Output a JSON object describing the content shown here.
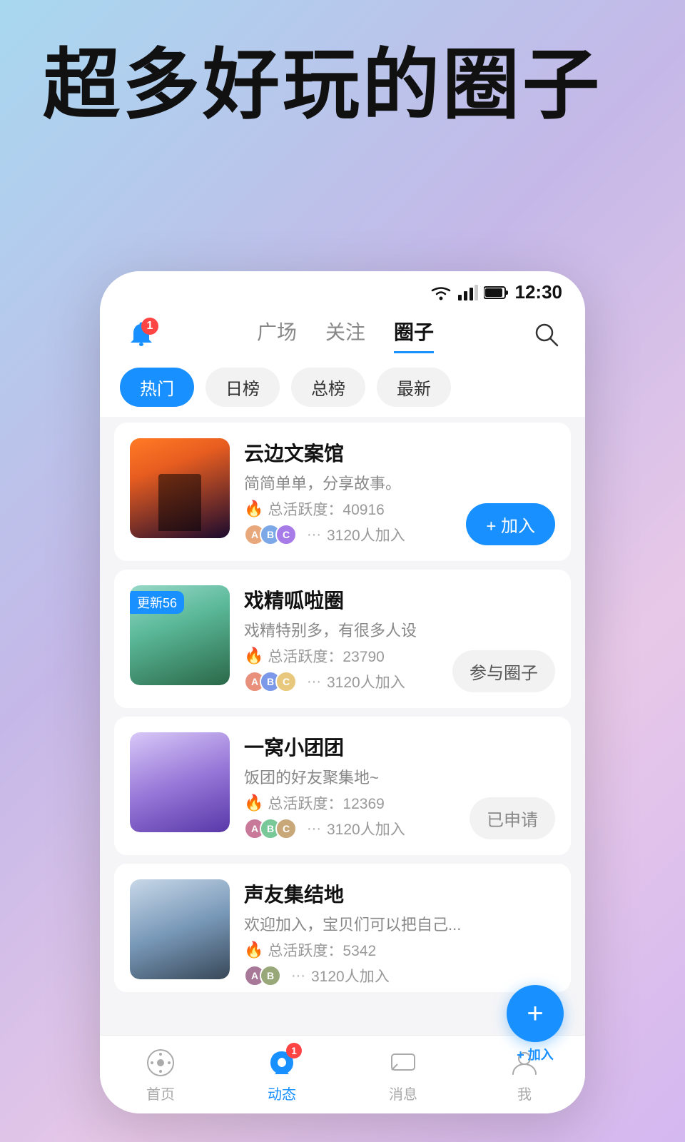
{
  "hero": {
    "title": "超多好玩的圈子"
  },
  "statusBar": {
    "time": "12:30"
  },
  "navBar": {
    "bellBadge": "1",
    "tabs": [
      {
        "label": "广场",
        "active": false
      },
      {
        "label": "关注",
        "active": false
      },
      {
        "label": "圈子",
        "active": true
      }
    ]
  },
  "filters": [
    {
      "label": "热门",
      "active": true
    },
    {
      "label": "日榜",
      "active": false
    },
    {
      "label": "总榜",
      "active": false
    },
    {
      "label": "最新",
      "active": false
    }
  ],
  "circles": [
    {
      "name": "云边文案馆",
      "desc": "简简单单，分享故事。",
      "activity": "总活跃度：40916",
      "members": "3120人加入",
      "actionLabel": "+ 加入",
      "actionType": "join",
      "updateBadge": null
    },
    {
      "name": "戏精呱啦圈",
      "desc": "戏精特别多，有很多人设",
      "activity": "总活跃度：23790",
      "members": "3120人加入",
      "actionLabel": "参与圈子",
      "actionType": "participate",
      "updateBadge": "更新56"
    },
    {
      "name": "一窝小团团",
      "desc": "饭团的好友聚集地~",
      "activity": "总活跃度：12369",
      "members": "3120人加入",
      "actionLabel": "已申请",
      "actionType": "applied",
      "updateBadge": null
    },
    {
      "name": "声友集结地",
      "desc": "欢迎加入，宝贝们可以把自己...",
      "activity": "总活跃度：5342",
      "members": "3120人加入",
      "actionLabel": "+ 加入",
      "actionType": "join",
      "updateBadge": null
    }
  ],
  "bottomNav": [
    {
      "label": "首页",
      "active": false,
      "badge": null
    },
    {
      "label": "动态",
      "active": true,
      "badge": "1"
    },
    {
      "label": "消息",
      "active": false,
      "badge": null
    },
    {
      "label": "我",
      "active": false,
      "badge": null
    }
  ],
  "fab": {
    "label": "+ 加入"
  }
}
